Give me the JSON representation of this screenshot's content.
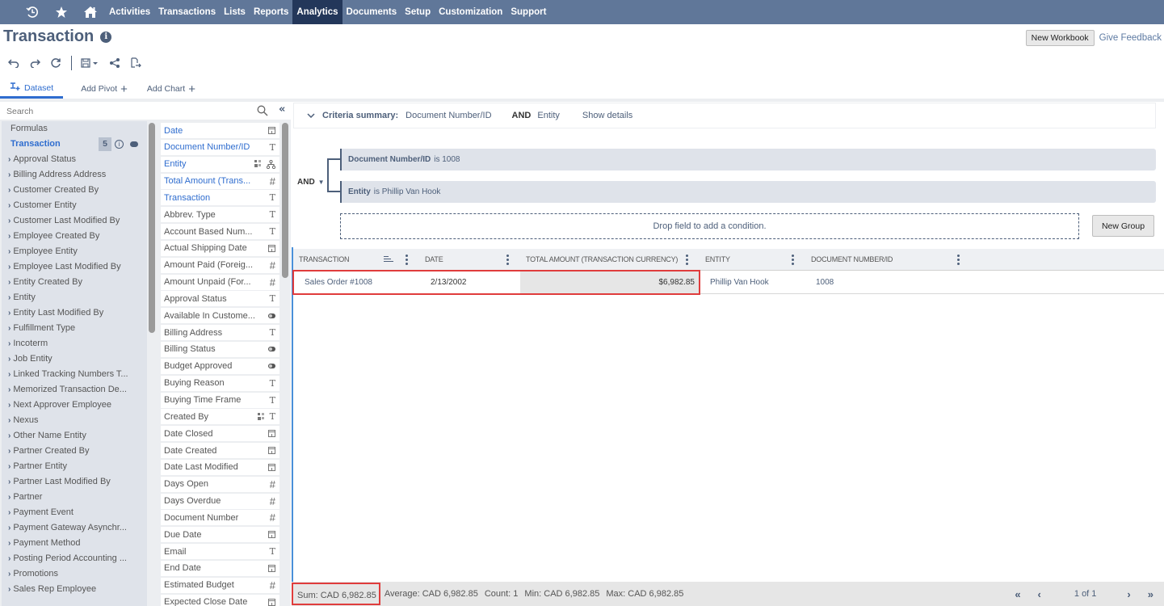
{
  "topnav": {
    "icons": [
      "recent-icon",
      "star-icon",
      "home-icon"
    ],
    "items": [
      {
        "label": "Activities",
        "active": false
      },
      {
        "label": "Transactions",
        "active": false
      },
      {
        "label": "Lists",
        "active": false
      },
      {
        "label": "Reports",
        "active": false
      },
      {
        "label": "Analytics",
        "active": true
      },
      {
        "label": "Documents",
        "active": false
      },
      {
        "label": "Setup",
        "active": false
      },
      {
        "label": "Customization",
        "active": false
      },
      {
        "label": "Support",
        "active": false
      }
    ]
  },
  "header": {
    "title": "Transaction",
    "new_workbook": "New Workbook",
    "give_feedback": "Give Feedback"
  },
  "toolbar": {
    "icons": [
      "undo-icon",
      "redo-icon",
      "refresh-icon",
      "save-icon",
      "share-icon",
      "export-icon"
    ]
  },
  "tabs": [
    {
      "label": "Dataset",
      "active": true,
      "icon": "dataset-icon"
    },
    {
      "label": "Add Pivot",
      "active": false,
      "icon": "plus-icon"
    },
    {
      "label": "Add Chart",
      "active": false,
      "icon": "plus-icon"
    }
  ],
  "search": {
    "placeholder": "Search",
    "value": ""
  },
  "records": {
    "formulas_label": "Formulas",
    "active_label": "Transaction",
    "active_count": "5",
    "items": [
      "Approval Status",
      "Billing Address Address",
      "Customer Created By",
      "Customer Entity",
      "Customer Last Modified By",
      "Employee Created By",
      "Employee Entity",
      "Employee Last Modified By",
      "Entity Created By",
      "Entity",
      "Entity Last Modified By",
      "Fulfillment Type",
      "Incoterm",
      "Job Entity",
      "Linked Tracking Numbers T...",
      "Memorized Transaction De...",
      "Next Approver Employee",
      "Nexus",
      "Other Name Entity",
      "Partner Created By",
      "Partner Entity",
      "Partner Last Modified By",
      "Partner",
      "Payment Event",
      "Payment Gateway Asynchr...",
      "Payment Method",
      "Posting Period Accounting ...",
      "Promotions",
      "Sales Rep Employee"
    ]
  },
  "fields": [
    {
      "label": "Date",
      "selected": true,
      "types": [
        "date"
      ]
    },
    {
      "label": "Document Number/ID",
      "selected": true,
      "types": [
        "text"
      ]
    },
    {
      "label": "Entity",
      "selected": true,
      "types": [
        "multi",
        "hierarchy"
      ]
    },
    {
      "label": "Total Amount (Trans...",
      "selected": true,
      "types": [
        "number"
      ]
    },
    {
      "label": "Transaction",
      "selected": true,
      "types": [
        "text"
      ]
    },
    {
      "label": "Abbrev. Type",
      "selected": false,
      "types": [
        "text"
      ]
    },
    {
      "label": "Account Based Num...",
      "selected": false,
      "types": [
        "text"
      ]
    },
    {
      "label": "Actual Shipping Date",
      "selected": false,
      "types": [
        "date"
      ]
    },
    {
      "label": "Amount Paid (Foreig...",
      "selected": false,
      "types": [
        "number"
      ]
    },
    {
      "label": "Amount Unpaid (For...",
      "selected": false,
      "types": [
        "number"
      ]
    },
    {
      "label": "Approval Status",
      "selected": false,
      "types": [
        "text"
      ]
    },
    {
      "label": "Available In Custome...",
      "selected": false,
      "types": [
        "boolean"
      ]
    },
    {
      "label": "Billing Address",
      "selected": false,
      "types": [
        "text"
      ]
    },
    {
      "label": "Billing Status",
      "selected": false,
      "types": [
        "boolean"
      ]
    },
    {
      "label": "Budget Approved",
      "selected": false,
      "types": [
        "boolean"
      ]
    },
    {
      "label": "Buying Reason",
      "selected": false,
      "types": [
        "text"
      ]
    },
    {
      "label": "Buying Time Frame",
      "selected": false,
      "types": [
        "text"
      ]
    },
    {
      "label": "Created By",
      "selected": false,
      "types": [
        "multi",
        "text"
      ]
    },
    {
      "label": "Date Closed",
      "selected": false,
      "types": [
        "date"
      ]
    },
    {
      "label": "Date Created",
      "selected": false,
      "types": [
        "date"
      ]
    },
    {
      "label": "Date Last Modified",
      "selected": false,
      "types": [
        "date"
      ]
    },
    {
      "label": "Days Open",
      "selected": false,
      "types": [
        "number"
      ]
    },
    {
      "label": "Days Overdue",
      "selected": false,
      "types": [
        "number"
      ]
    },
    {
      "label": "Document Number",
      "selected": false,
      "types": [
        "number"
      ]
    },
    {
      "label": "Due Date",
      "selected": false,
      "types": [
        "date"
      ]
    },
    {
      "label": "Email",
      "selected": false,
      "types": [
        "text"
      ]
    },
    {
      "label": "End Date",
      "selected": false,
      "types": [
        "date"
      ]
    },
    {
      "label": "Estimated Budget",
      "selected": false,
      "types": [
        "number"
      ]
    },
    {
      "label": "Expected Close Date",
      "selected": false,
      "types": [
        "date"
      ]
    }
  ],
  "criteria": {
    "summary_label": "Criteria summary:",
    "summary_field1": "Document Number/ID",
    "summary_and": "AND",
    "summary_field2": "Entity",
    "show_details": "Show details",
    "operator": "AND",
    "conditions": [
      {
        "field": "Document Number/ID",
        "text": "is 1008"
      },
      {
        "field": "Entity",
        "text": "is Phillip Van Hook"
      }
    ],
    "drop_hint": "Drop field to add a condition.",
    "new_group": "New Group"
  },
  "grid": {
    "columns": [
      "TRANSACTION",
      "DATE",
      "TOTAL AMOUNT (TRANSACTION CURRENCY)",
      "ENTITY",
      "DOCUMENT NUMBER/ID"
    ],
    "rows": [
      {
        "transaction": "Sales Order #1008",
        "date": "2/13/2002",
        "total": "$6,982.85",
        "entity": "Phillip Van Hook",
        "doc": "1008"
      }
    ]
  },
  "footer": {
    "sum": "Sum: CAD 6,982.85",
    "average": "Average: CAD 6,982.85",
    "count": "Count: 1",
    "min": "Min: CAD 6,982.85",
    "max": "Max: CAD 6,982.85",
    "page": "1 of 1"
  },
  "colors": {
    "nav_bg": "#607799",
    "nav_active": "#23375a",
    "accent": "#2f6dcf",
    "highlight": "#e03c3c"
  }
}
